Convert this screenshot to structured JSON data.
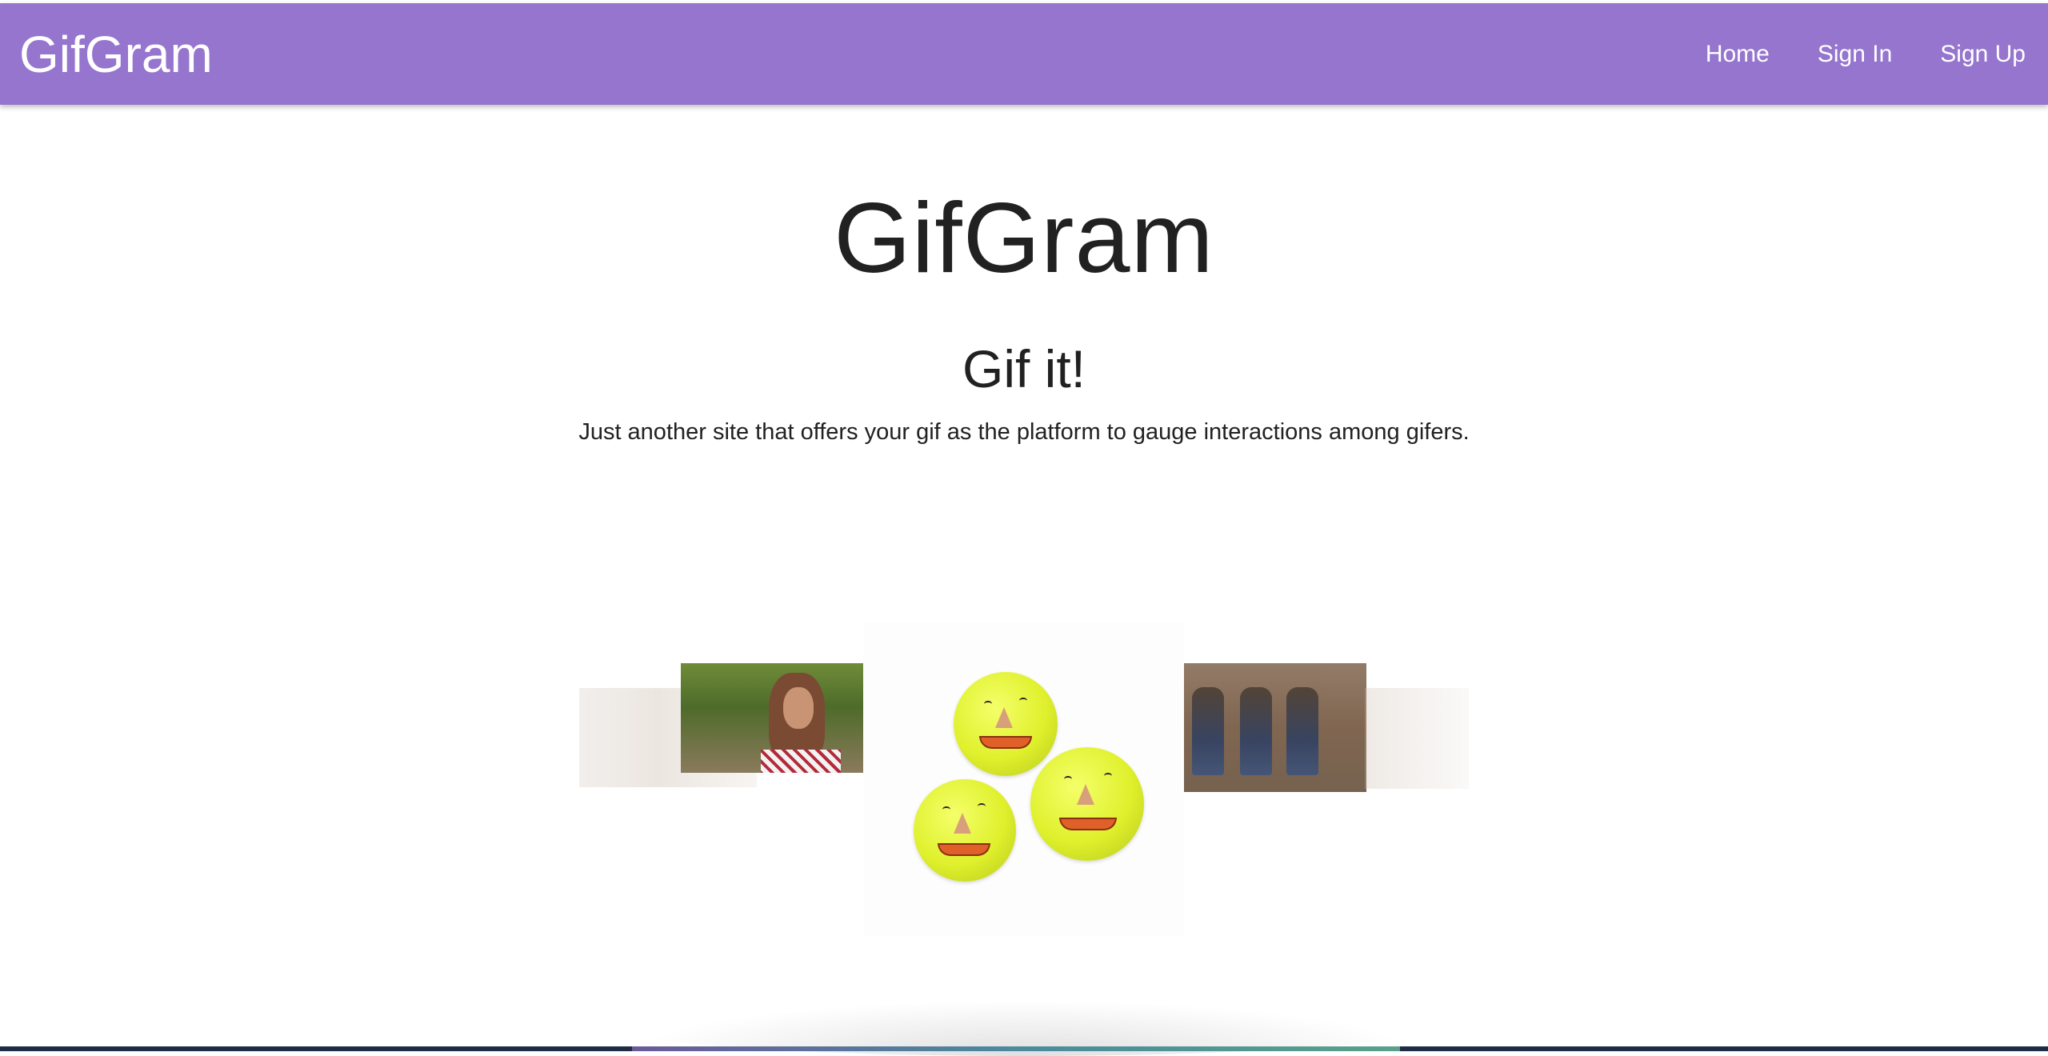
{
  "navbar": {
    "brand": "GifGram",
    "background_color": "#9575cd",
    "links": [
      {
        "label": "Home"
      },
      {
        "label": "Sign In"
      },
      {
        "label": "Sign Up"
      }
    ]
  },
  "hero": {
    "title": "GifGram",
    "subtitle": "Gif it!",
    "description": "Just another site that offers your gif as the platform to gauge interactions among gifers."
  },
  "carousel": {
    "items": [
      {
        "name": "gif-woman-smiling"
      },
      {
        "name": "gif-woman-garden"
      },
      {
        "name": "gif-tennis-balls-faces"
      },
      {
        "name": "gif-cowboys-sitting"
      },
      {
        "name": "gif-faded-right"
      }
    ],
    "active_index": 2
  }
}
